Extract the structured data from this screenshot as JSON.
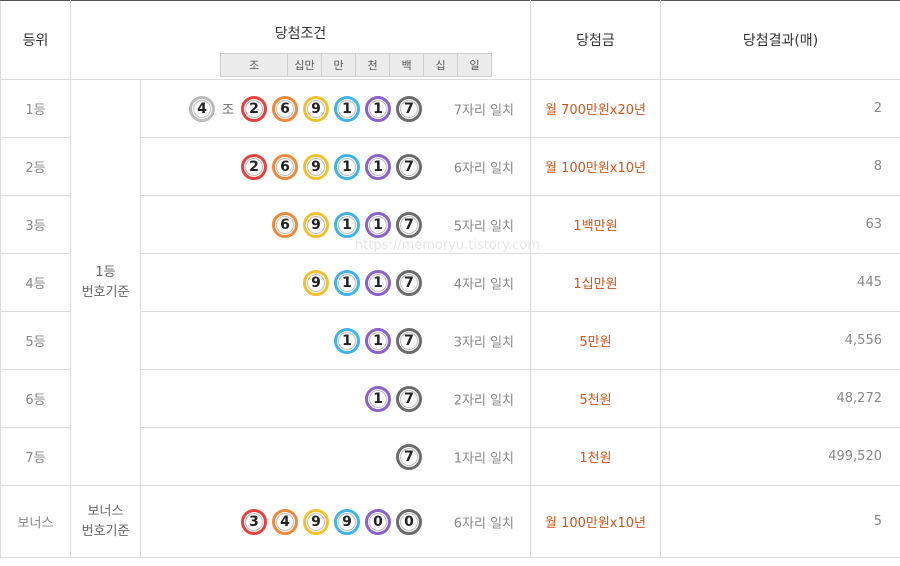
{
  "header": {
    "rank": "등위",
    "condition": "당첨조건",
    "prize": "당첨금",
    "result": "당첨결과(매)",
    "digit_labels": [
      "조",
      "십만",
      "만",
      "천",
      "백",
      "십",
      "일"
    ]
  },
  "basis_main": [
    "1등",
    "번호기준"
  ],
  "basis_bonus": [
    "보너스",
    "번호기준"
  ],
  "jo_label": "조",
  "watermark": "https://memoryu.tistory.com",
  "rows": [
    {
      "rank": "1등",
      "group": "4",
      "balls": [
        {
          "v": "2",
          "c": "red"
        },
        {
          "v": "6",
          "c": "orange"
        },
        {
          "v": "9",
          "c": "yellow"
        },
        {
          "v": "1",
          "c": "blue"
        },
        {
          "v": "1",
          "c": "purple"
        },
        {
          "v": "7",
          "c": "gray"
        }
      ],
      "match": "7자리 일치",
      "prize": "월 700만원x20년",
      "result": "2"
    },
    {
      "rank": "2등",
      "balls": [
        {
          "v": "2",
          "c": "red"
        },
        {
          "v": "6",
          "c": "orange"
        },
        {
          "v": "9",
          "c": "yellow"
        },
        {
          "v": "1",
          "c": "blue"
        },
        {
          "v": "1",
          "c": "purple"
        },
        {
          "v": "7",
          "c": "gray"
        }
      ],
      "match": "6자리 일치",
      "prize": "월 100만원x10년",
      "result": "8"
    },
    {
      "rank": "3등",
      "balls": [
        {
          "v": "6",
          "c": "orange"
        },
        {
          "v": "9",
          "c": "yellow"
        },
        {
          "v": "1",
          "c": "blue"
        },
        {
          "v": "1",
          "c": "purple"
        },
        {
          "v": "7",
          "c": "gray"
        }
      ],
      "match": "5자리 일치",
      "prize": "1백만원",
      "result": "63"
    },
    {
      "rank": "4등",
      "balls": [
        {
          "v": "9",
          "c": "yellow"
        },
        {
          "v": "1",
          "c": "blue"
        },
        {
          "v": "1",
          "c": "purple"
        },
        {
          "v": "7",
          "c": "gray"
        }
      ],
      "match": "4자리 일치",
      "prize": "1십만원",
      "result": "445"
    },
    {
      "rank": "5등",
      "balls": [
        {
          "v": "1",
          "c": "blue"
        },
        {
          "v": "1",
          "c": "purple"
        },
        {
          "v": "7",
          "c": "gray"
        }
      ],
      "match": "3자리 일치",
      "prize": "5만원",
      "result": "4,556"
    },
    {
      "rank": "6등",
      "balls": [
        {
          "v": "1",
          "c": "purple"
        },
        {
          "v": "7",
          "c": "gray"
        }
      ],
      "match": "2자리 일치",
      "prize": "5천원",
      "result": "48,272"
    },
    {
      "rank": "7등",
      "balls": [
        {
          "v": "7",
          "c": "gray"
        }
      ],
      "match": "1자리 일치",
      "prize": "1천원",
      "result": "499,520"
    }
  ],
  "bonus": {
    "rank": "보너스",
    "balls": [
      {
        "v": "3",
        "c": "red"
      },
      {
        "v": "4",
        "c": "orange"
      },
      {
        "v": "9",
        "c": "yellow"
      },
      {
        "v": "9",
        "c": "blue"
      },
      {
        "v": "0",
        "c": "purple"
      },
      {
        "v": "0",
        "c": "gray"
      }
    ],
    "match": "6자리 일치",
    "prize": "월 100만원x10년",
    "result": "5"
  }
}
